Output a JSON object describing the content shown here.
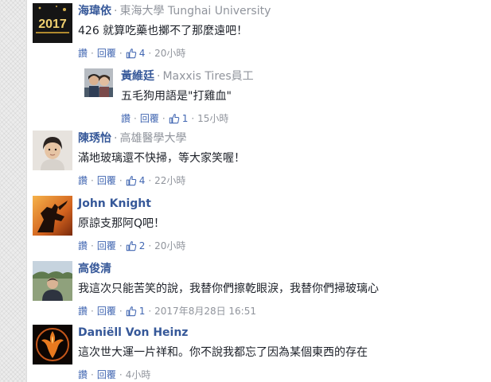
{
  "colors": {
    "author": "#365899",
    "link": "#4267b2",
    "meta": "#90949c",
    "text": "#1d2129"
  },
  "comments": [
    {
      "author": "海瑋依",
      "affiliation": "東海大學 Tunghai University",
      "text": "426 就算吃藥也擲不了那麼遠吧！",
      "actions": {
        "like": "讚",
        "reply": "回覆",
        "likes": "4",
        "time": "20小時"
      },
      "avatar": {
        "label": "2017",
        "icon": "avatar-2017-icon"
      }
    },
    {
      "author": "黃維廷",
      "affiliation": "Maxxis Tires員工",
      "text": "五毛狗用語是\"打雞血\"",
      "actions": {
        "like": "讚",
        "reply": "回覆",
        "likes": "1",
        "time": "15小時"
      },
      "avatar": {
        "icon": "couple-photo-icon"
      }
    },
    {
      "author": "陳琇怡",
      "affiliation": "高雄醫學大學",
      "text": "滿地玻璃還不快掃，等大家笑喔！",
      "actions": {
        "like": "讚",
        "reply": "回覆",
        "likes": "4",
        "time": "22小時"
      },
      "avatar": {
        "icon": "woman-portrait-icon"
      }
    },
    {
      "author": "John Knight",
      "affiliation": "",
      "text": "原諒支那阿Q吧！",
      "actions": {
        "like": "讚",
        "reply": "回覆",
        "likes": "2",
        "time": "20小時"
      },
      "avatar": {
        "icon": "knight-silhouette-icon"
      }
    },
    {
      "author": "高俊清",
      "affiliation": "",
      "text": "我這次只能苦笑的說，我替你們擦乾眼淚，我替你們掃玻璃心",
      "actions": {
        "like": "讚",
        "reply": "回覆",
        "likes": "1",
        "time": "2017年8月28日 16:51"
      },
      "avatar": {
        "icon": "man-outdoor-icon"
      }
    },
    {
      "author": "Daniëll Von Heinz",
      "affiliation": "",
      "text": "這次世大運一片祥和。你不說我都忘了因為某個東西的存在",
      "actions": {
        "like": "讚",
        "reply": "回覆",
        "likes": "",
        "time": "4小時"
      },
      "avatar": {
        "icon": "phoenix-icon"
      }
    }
  ]
}
